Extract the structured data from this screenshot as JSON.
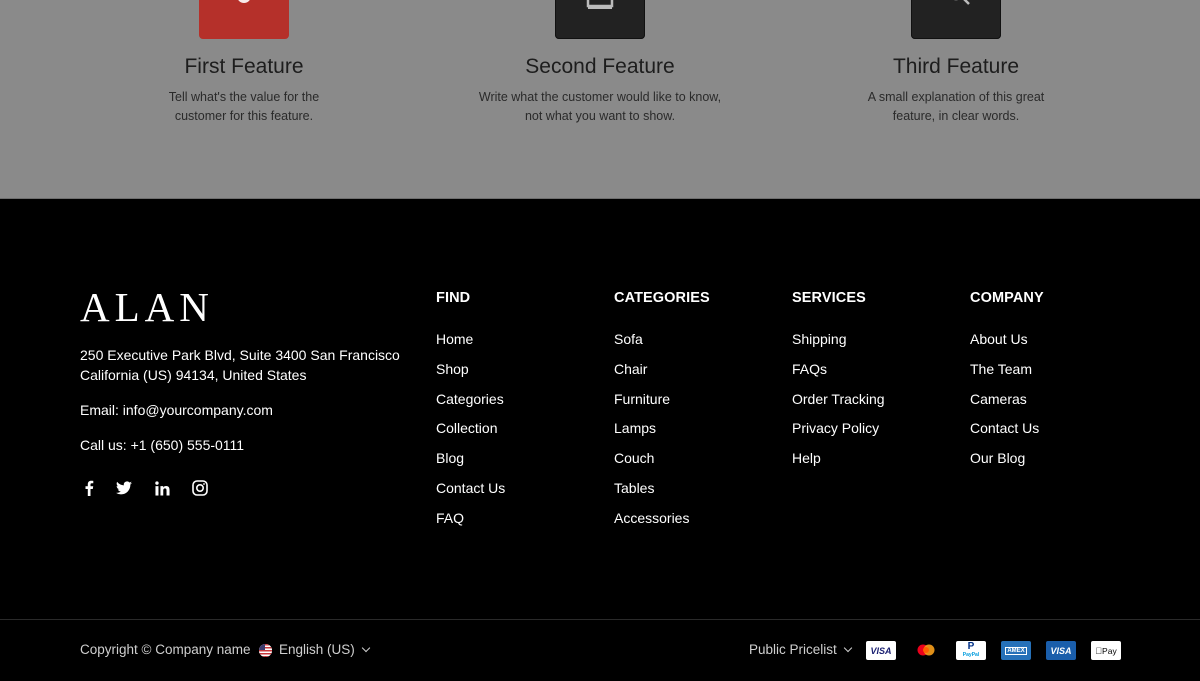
{
  "features": [
    {
      "title": "First Feature",
      "desc_line1": "Tell what's the value for the",
      "desc_line2": "customer for this feature.",
      "icon": "gear-icon",
      "icon_bg": "#b5302a"
    },
    {
      "title": "Second Feature",
      "desc_line1": "Write what the customer would like to know,",
      "desc_line2": "not what you want to show.",
      "icon": "monitor-icon",
      "icon_bg": "#222222"
    },
    {
      "title": "Third Feature",
      "desc_line1": "A small explanation of this great",
      "desc_line2": "feature, in clear words.",
      "icon": "chat-icon",
      "icon_bg": "#222222"
    }
  ],
  "footer": {
    "logo": "ALAN",
    "address_line1": "250 Executive Park Blvd, Suite 3400 San Francisco",
    "address_line2": "California (US) 94134, United States",
    "email": "Email: info@yourcompany.com",
    "phone": "Call us: +1 (650) 555-0111",
    "social": [
      "facebook-icon",
      "twitter-icon",
      "linkedin-icon",
      "instagram-icon"
    ],
    "columns": [
      {
        "heading": "FIND",
        "items": [
          "Home",
          "Shop",
          "Categories",
          "Collection",
          "Blog",
          "Contact Us",
          "FAQ"
        ]
      },
      {
        "heading": "CATEGORIES",
        "items": [
          "Sofa",
          "Chair",
          "Furniture",
          "Lamps",
          "Couch",
          "Tables",
          "Accessories"
        ]
      },
      {
        "heading": "SERVICES",
        "items": [
          "Shipping",
          "FAQs",
          "Order Tracking",
          "Privacy Policy",
          "Help"
        ]
      },
      {
        "heading": "COMPANY",
        "items": [
          "About Us",
          "The Team",
          "Cameras",
          "Contact Us",
          "Our Blog"
        ]
      }
    ]
  },
  "bottom_bar": {
    "copyright": "Copyright © Company name",
    "language": "English (US)",
    "pricelist": "Public Pricelist",
    "payments": [
      {
        "name": "visa-icon",
        "label": "VISA"
      },
      {
        "name": "mastercard-icon",
        "label": ""
      },
      {
        "name": "paypal-icon",
        "label": "PayPal"
      },
      {
        "name": "amex-icon",
        "label": "AMEX"
      },
      {
        "name": "visa-electron-icon",
        "label": "VISA"
      },
      {
        "name": "apple-pay-icon",
        "label": "Pay"
      }
    ]
  }
}
